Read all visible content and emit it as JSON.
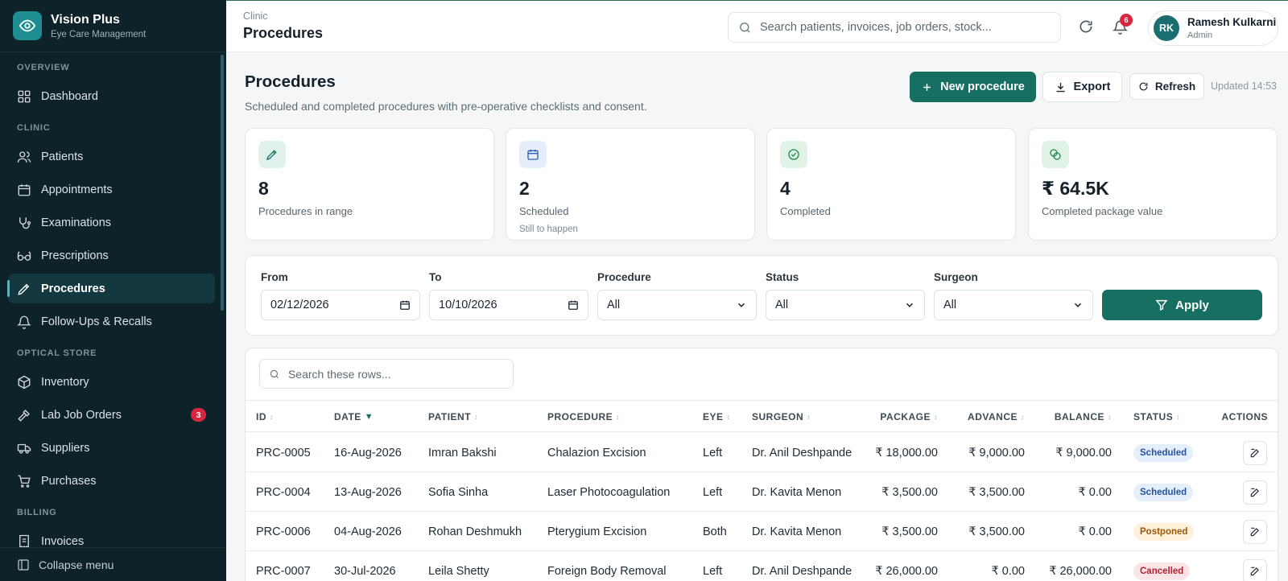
{
  "brand": {
    "name": "Vision Plus",
    "subtitle": "Eye Care Management"
  },
  "sidebar": {
    "sections": {
      "overview": "OVERVIEW",
      "clinic": "CLINIC",
      "optical_store": "OPTICAL STORE",
      "billing": "BILLING"
    },
    "items": {
      "dashboard": "Dashboard",
      "patients": "Patients",
      "appointments": "Appointments",
      "examinations": "Examinations",
      "prescriptions": "Prescriptions",
      "procedures": "Procedures",
      "followups": "Follow-Ups & Recalls",
      "inventory": "Inventory",
      "lab_job_orders": "Lab Job Orders",
      "lab_job_orders_badge": "3",
      "suppliers": "Suppliers",
      "purchases": "Purchases",
      "invoices": "Invoices"
    },
    "collapse_label": "Collapse menu"
  },
  "topbar": {
    "breadcrumb": "Clinic",
    "title": "Procedures",
    "search_placeholder": "Search patients, invoices, job orders, stock...",
    "notifications_count": "6",
    "user": {
      "initials": "RK",
      "name": "Ramesh Kulkarni",
      "role": "Admin"
    }
  },
  "header": {
    "title": "Procedures",
    "subtitle": "Scheduled and completed procedures with pre-operative checklists and consent.",
    "new_label": "New procedure",
    "export_label": "Export",
    "refresh_label": "Refresh",
    "updated": "Updated 14:53"
  },
  "stats": [
    {
      "value": "8",
      "label": "Procedures in range",
      "hint": ""
    },
    {
      "value": "2",
      "label": "Scheduled",
      "hint": "Still to happen"
    },
    {
      "value": "4",
      "label": "Completed",
      "hint": ""
    },
    {
      "value": "₹ 64.5K",
      "label": "Completed package value",
      "hint": ""
    }
  ],
  "filters": {
    "from_label": "From",
    "from_value": "02/12/2026",
    "to_label": "To",
    "to_value": "10/10/2026",
    "procedure_label": "Procedure",
    "procedure_value": "All",
    "status_label": "Status",
    "status_value": "All",
    "surgeon_label": "Surgeon",
    "surgeon_value": "All",
    "apply_label": "Apply"
  },
  "table": {
    "search_placeholder": "Search these rows...",
    "headers": {
      "id": "ID",
      "date": "DATE",
      "patient": "PATIENT",
      "procedure": "PROCEDURE",
      "eye": "EYE",
      "surgeon": "SURGEON",
      "package": "PACKAGE",
      "advance": "ADVANCE",
      "balance": "BALANCE",
      "status": "STATUS",
      "actions": "ACTIONS"
    },
    "rows": [
      {
        "id": "PRC-0005",
        "date": "16-Aug-2026",
        "patient": "Imran Bakshi",
        "procedure": "Chalazion Excision",
        "eye": "Left",
        "surgeon": "Dr. Anil Deshpande",
        "package": "₹ 18,000.00",
        "advance": "₹ 9,000.00",
        "balance": "₹ 9,000.00",
        "status": "Scheduled"
      },
      {
        "id": "PRC-0004",
        "date": "13-Aug-2026",
        "patient": "Sofia Sinha",
        "procedure": "Laser Photocoagulation",
        "eye": "Left",
        "surgeon": "Dr. Kavita Menon",
        "package": "₹ 3,500.00",
        "advance": "₹ 3,500.00",
        "balance": "₹ 0.00",
        "status": "Scheduled"
      },
      {
        "id": "PRC-0006",
        "date": "04-Aug-2026",
        "patient": "Rohan Deshmukh",
        "procedure": "Pterygium Excision",
        "eye": "Both",
        "surgeon": "Dr. Kavita Menon",
        "package": "₹ 3,500.00",
        "advance": "₹ 3,500.00",
        "balance": "₹ 0.00",
        "status": "Postponed"
      },
      {
        "id": "PRC-0007",
        "date": "30-Jul-2026",
        "patient": "Leila Shetty",
        "procedure": "Foreign Body Removal",
        "eye": "Left",
        "surgeon": "Dr. Anil Deshpande",
        "package": "₹ 26,000.00",
        "advance": "₹ 0.00",
        "balance": "₹ 26,000.00",
        "status": "Cancelled"
      }
    ]
  },
  "colors": {
    "brand": "#176f62",
    "sidebar": "#0d2229",
    "danger": "#d7263d"
  }
}
